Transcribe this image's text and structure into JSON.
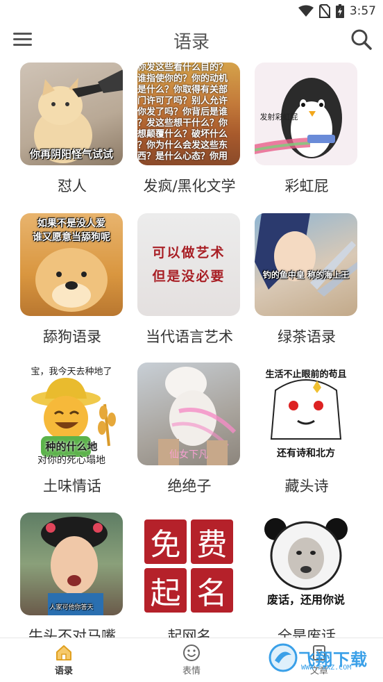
{
  "status": {
    "time": "3:57"
  },
  "header": {
    "title": "语录"
  },
  "captions": {
    "c1": "你再阴阳怪气试试",
    "c2": [
      "你发这些看什么目的？",
      "谁指使你的？你的动机",
      "是什么？你取得有关部",
      "门许可了吗？别人允许",
      "你发了吗？你背后是谁",
      "？发这些想干什么？你",
      "想颠覆什么？破坏什么",
      "？你为什么会发这些东",
      "西？是什么心态？你用"
    ],
    "c3": "发射彩虹屁",
    "c4": [
      "如果不是没人爱",
      "谁又愿意当舔狗呢"
    ],
    "c5": [
      "可以做艺术",
      "但是没必要"
    ],
    "c6": "钓的鱼中皇 称的海上王",
    "c7": [
      "宝，我今天去种地了",
      "种的什么地",
      "对你的死心塌地"
    ],
    "c8": "仙女下凡",
    "c9": [
      "生活不止眼前的苟且",
      "还有诗和北方"
    ],
    "c10": "人家可他你答天",
    "c11": [
      "免",
      "费",
      "起",
      "名"
    ],
    "c12": "废话，还用你说"
  },
  "categories": [
    {
      "label": "怼人"
    },
    {
      "label": "发疯/黑化文学"
    },
    {
      "label": "彩虹屁"
    },
    {
      "label": "舔狗语录"
    },
    {
      "label": "当代语言艺术"
    },
    {
      "label": "绿茶语录"
    },
    {
      "label": "土味情话"
    },
    {
      "label": "绝绝子"
    },
    {
      "label": "藏头诗"
    },
    {
      "label": "牛头不对马嘴"
    },
    {
      "label": "起网名"
    },
    {
      "label": "全是废话"
    }
  ],
  "nav": [
    {
      "label": "语录"
    },
    {
      "label": "表情"
    },
    {
      "label": "文章"
    }
  ],
  "watermark": {
    "text": "飞翔下载",
    "url": "WWW.FXXZ.COM"
  },
  "colors": {
    "accent": "#f2a71b",
    "watermark": "#3aa0e8"
  }
}
